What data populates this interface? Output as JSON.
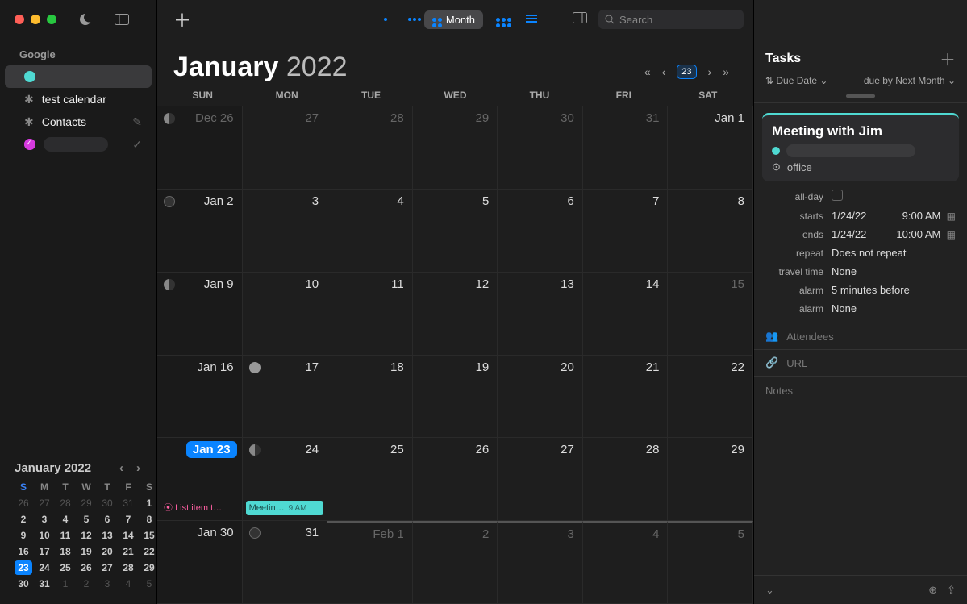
{
  "sidebar": {
    "account": "Google",
    "items": [
      {
        "label": ""
      },
      {
        "label": "test calendar"
      },
      {
        "label": "Contacts"
      },
      {
        "label": ""
      }
    ]
  },
  "toolbar": {
    "view_label": "Month",
    "search_placeholder": "Search"
  },
  "month": {
    "name": "January",
    "year": "2022",
    "today_chip": "23",
    "dows": [
      "SUN",
      "MON",
      "TUE",
      "WED",
      "THU",
      "FRI",
      "SAT"
    ],
    "cells": [
      [
        "Dec 26",
        "27",
        "28",
        "29",
        "30",
        "31",
        "Jan 1"
      ],
      [
        "Jan 2",
        "3",
        "4",
        "5",
        "6",
        "7",
        "8"
      ],
      [
        "Jan 9",
        "10",
        "11",
        "12",
        "13",
        "14",
        "15"
      ],
      [
        "Jan 16",
        "17",
        "18",
        "19",
        "20",
        "21",
        "22"
      ],
      [
        "Jan 23",
        "24",
        "25",
        "26",
        "27",
        "28",
        "29"
      ],
      [
        "Jan 30",
        "31",
        "Feb 1",
        "2",
        "3",
        "4",
        "5"
      ]
    ],
    "events": {
      "jan23": "List item t…",
      "jan24": "Meetin…",
      "jan24_time": "9 AM"
    }
  },
  "mini": {
    "title": "January 2022",
    "dows": [
      "S",
      "M",
      "T",
      "W",
      "T",
      "F",
      "S"
    ],
    "rows": [
      [
        "26",
        "27",
        "28",
        "29",
        "30",
        "31",
        "1"
      ],
      [
        "2",
        "3",
        "4",
        "5",
        "6",
        "7",
        "8"
      ],
      [
        "9",
        "10",
        "11",
        "12",
        "13",
        "14",
        "15"
      ],
      [
        "16",
        "17",
        "18",
        "19",
        "20",
        "21",
        "22"
      ],
      [
        "23",
        "24",
        "25",
        "26",
        "27",
        "28",
        "29"
      ],
      [
        "30",
        "31",
        "1",
        "2",
        "3",
        "4",
        "5"
      ]
    ]
  },
  "tasks": {
    "heading": "Tasks",
    "sort1": "Due Date",
    "sort2": "due by Next Month"
  },
  "event": {
    "title": "Meeting with Jim",
    "location": "office",
    "allday_label": "all-day",
    "starts_label": "starts",
    "starts_date": "1/24/22",
    "starts_time": "9:00 AM",
    "ends_label": "ends",
    "ends_date": "1/24/22",
    "ends_time": "10:00 AM",
    "repeat_label": "repeat",
    "repeat_value": "Does not repeat",
    "travel_label": "travel time",
    "travel_value": "None",
    "alarm1_label": "alarm",
    "alarm1_value": "5 minutes before",
    "alarm2_label": "alarm",
    "alarm2_value": "None",
    "attendees": "Attendees",
    "url": "URL",
    "notes": "Notes"
  }
}
